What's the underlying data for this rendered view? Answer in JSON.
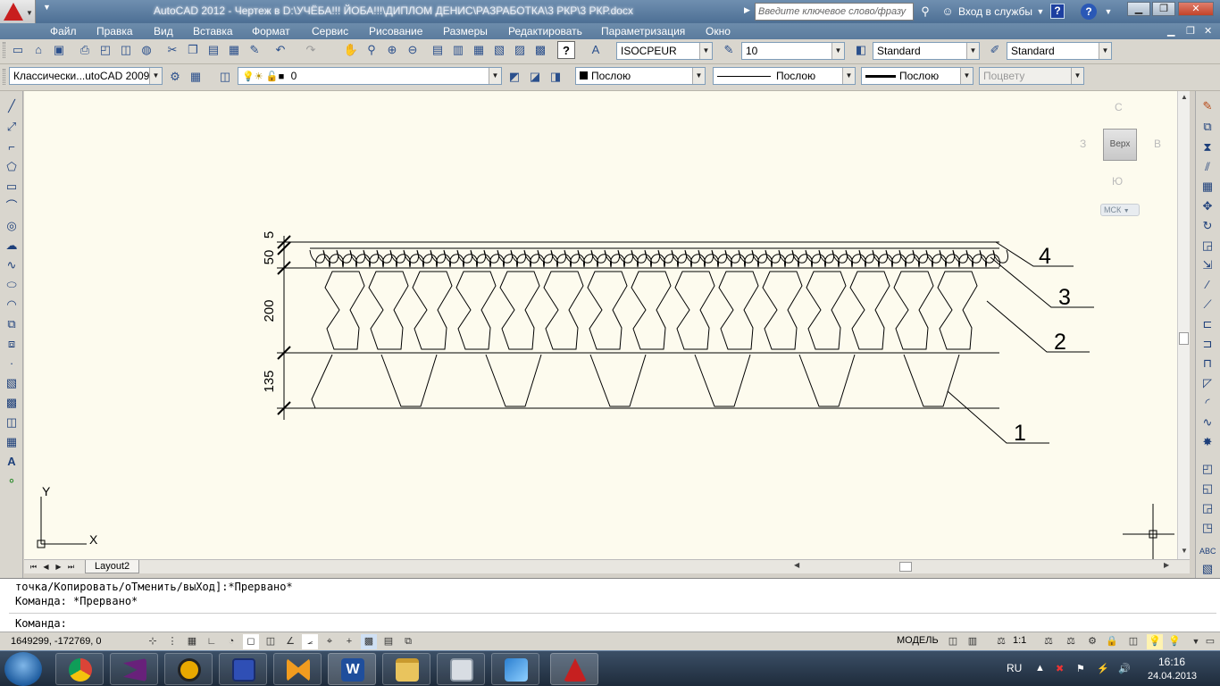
{
  "title_bar": {
    "app_title": "AutoCAD 2012 - Чертеж в D:\\УЧЁБА!!! ЙОБА!!!\\ДИПЛОМ ДЕНИС\\РАЗРАБОТКА\\3 РКР\\3 РКР.docx",
    "search_placeholder": "Введите ключевое слово/фразу",
    "login_label": "Вход в службы",
    "help_label": "?"
  },
  "menu": {
    "items": [
      "Файл",
      "Правка",
      "Вид",
      "Вставка",
      "Формат",
      "Сервис",
      "Рисование",
      "Размеры",
      "Редактировать",
      "Параметризация",
      "Окно"
    ]
  },
  "toolbar": {
    "text_style": "ISOCPEUR",
    "text_height": "10",
    "dim_style": "Standard",
    "table_style": "Standard",
    "workspace": "Классически...utoCAD 2009",
    "layer": "0",
    "color": "Послою",
    "linetype": "Послою",
    "lineweight": "Послою",
    "plotstyle": "Поцвету"
  },
  "drawing": {
    "dimensions": [
      "5",
      "50",
      "200",
      "135"
    ],
    "callouts": [
      "4",
      "3",
      "2",
      "1"
    ],
    "axis_y": "Y",
    "axis_x": "X"
  },
  "viewcube": {
    "face": "Верх",
    "north": "С",
    "south": "Ю",
    "west": "З",
    "east": "В",
    "ucs": "МСК"
  },
  "layout": {
    "tab": "Layout2"
  },
  "command": {
    "line1": "точка/Копировать/оТменить/выХод]:*Прервано*",
    "line2": "Команда: *Прервано*",
    "prompt": "Команда:"
  },
  "status": {
    "coords": "1649299, -172769, 0",
    "model": "МОДЕЛЬ",
    "scale": "1:1"
  },
  "taskbar": {
    "lang": "RU",
    "time": "16:16",
    "date": "24.04.2013"
  }
}
